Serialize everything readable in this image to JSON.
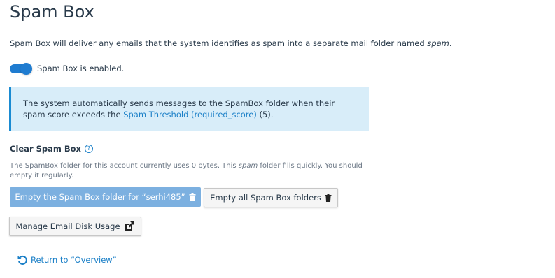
{
  "header": {
    "title": "Spam Box"
  },
  "intro": {
    "text_before": "Spam Box will deliver any emails that the system identifies as spam into a separate mail folder named ",
    "folder_name": "spam",
    "text_after": "."
  },
  "toggle": {
    "state": "on",
    "label": "Spam Box is enabled."
  },
  "info": {
    "text_before": "The system automatically sends messages to the SpamBox folder when their spam score exceeds the ",
    "link_text": "Spam Threshold (required_score)",
    "text_after": " (5)."
  },
  "clear_section": {
    "heading": "Clear Spam Box",
    "help_icon": "question-circle-icon",
    "usage_before": "The SpamBox folder for this account currently uses 0 bytes. This ",
    "usage_folder": "spam",
    "usage_after": " folder fills quickly. You should empty it regularly."
  },
  "buttons": {
    "empty_account": "Empty the Spam Box folder for “serhi485”",
    "empty_all": "Empty all Spam Box folders",
    "manage_disk": "Manage Email Disk Usage",
    "trash_icon": "trash-icon",
    "external_link_icon": "external-link-icon"
  },
  "footer": {
    "return_label": "Return to “Overview”",
    "return_icon": "undo-icon"
  },
  "colors": {
    "accent": "#1f7cd0",
    "link": "#1a7fc7",
    "info_bg": "#d8edf9",
    "primary_button_bg": "#7cb0e0"
  }
}
